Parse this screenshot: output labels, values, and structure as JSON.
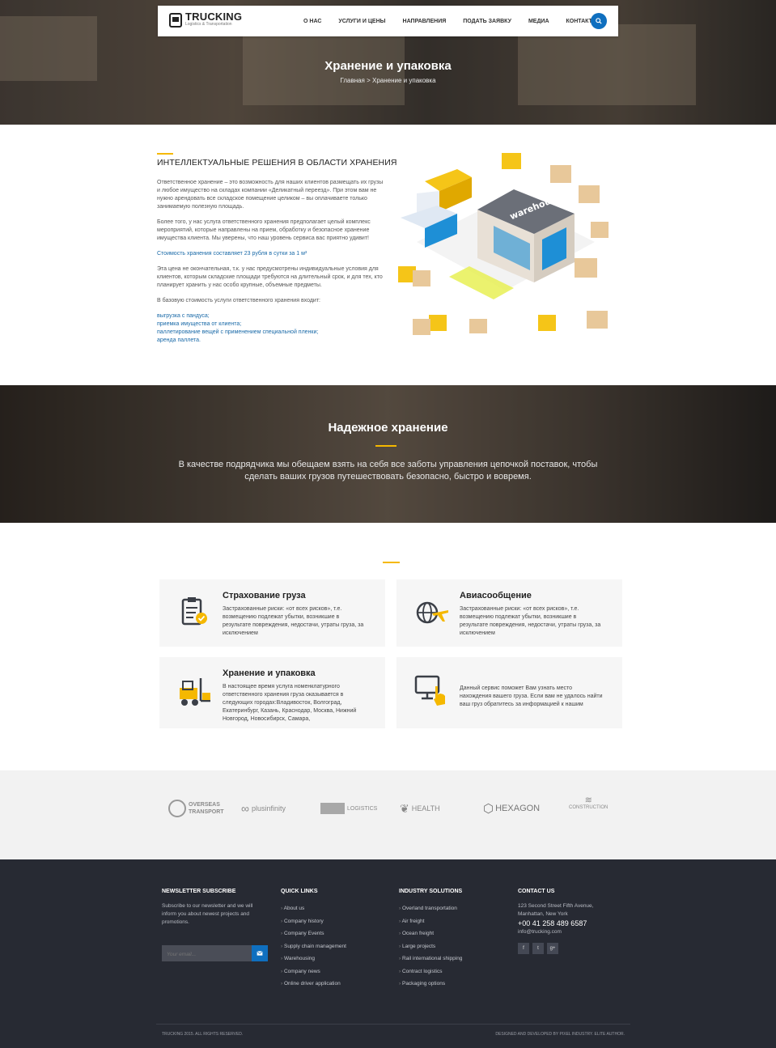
{
  "header": {
    "logo_title": "TRUCKING",
    "logo_subtitle": "Logistics & Transportation",
    "nav": [
      "О НАС",
      "УСЛУГИ И ЦЕНЫ",
      "НАПРАВЛЕНИЯ",
      "ПОДАТЬ ЗАЯВКУ",
      "МЕДИА",
      "КОНТАКТЫ"
    ],
    "page_title": "Хранение и упаковка",
    "breadcrumb": "Главная > Хранение и упаковка"
  },
  "intro": {
    "title": "ИНТЕЛЛЕКТУАЛЬНЫЕ РЕШЕНИЯ В ОБЛАСТИ ХРАНЕНИЯ",
    "p1": "Ответственное хранение – это возможность для наших клиентов размещать их грузы и любое имущество на складах компании «Деликатный переезд». При этом вам не нужно арендовать все складское помещение целиком – вы оплачиваете только занимаемую полезную площадь.",
    "p2": "Более того, у нас услуга ответственного хранения предполагает целый комплекс мероприятий, которые направлены на прием, обработку и безопасное хранение имущества клиента. Мы уверены, что наш уровень сервиса вас приятно удивит!",
    "price": "Стоимость хранения составляет 23 рубля в сутки за 1 м³",
    "p3": "Эта цена не окончательная, т.к. у нас предусмотрены индивидуальные условия для клиентов, которым складские площади требуются на длительный срок, и для тех, кто планирует хранить у нас особо крупные, объемные предметы.",
    "p4": "В базовую стоимость услуги ответственного хранения входит:",
    "list": [
      "выгрузка с пандуса;",
      "приемка имущества от клиента;",
      "паллетирование вещей с применением специальной пленки;",
      "аренда паллета."
    ],
    "illustration_label": "warehouse"
  },
  "banner": {
    "title": "Надежное хранение",
    "text": "В качестве подрядчика мы обещаем взять на себя все заботы управления цепочкой поставок, чтобы сделать ваших грузов путешествовать безопасно, быстро и вовремя."
  },
  "services": [
    {
      "title": "Страхование груза",
      "text": "Застрахованные риски: «от всех рисков», т.е. возмещению подлежат убытки, возникшие в результате повреждения, недостачи, утраты груза, за исключением",
      "icon": "clipboard-check-icon"
    },
    {
      "title": "Авиасообщение",
      "text": "Застрахованные риски: «от всех рисков», т.е. возмещению подлежат убытки, возникшие в результате повреждения, недостачи, утраты груза, за исключением",
      "icon": "globe-plane-icon"
    },
    {
      "title": "Хранение и упаковка",
      "text": "В настоящее время услуга номенклатурного ответственного хранения груза оказывается в следующих городах:Владивосток, Волгоград, Екатеринбург, Казань, Краснодар, Москва, Нижний Новгород, Новосибирск, Самара,",
      "icon": "forklift-icon"
    },
    {
      "title": "",
      "text": "Данный сервис поможет Вам узнать место нахождения вашего груза. Если вам не удалось найти ваш груз обратитесь за информацией к нашим",
      "icon": "monitor-hand-icon"
    }
  ],
  "partners": {
    "p1_line1": "OVERSEAS",
    "p1_line2": "TRANSPORT",
    "p2": "plusinfinity",
    "p3": "LOGISTICS",
    "p4": "HEALTH",
    "p5": "HEXAGON",
    "p6": "CONSTRUCTION"
  },
  "footer": {
    "newsletter_title": "NEWSLETTER SUBSCRIBE",
    "newsletter_text": "Subscribe to our newsletter and we will inform you about newest projects and promotions.",
    "email_placeholder": "Your email...",
    "quick_title": "QUICK LINKS",
    "quick_links": [
      "About us",
      "Company history",
      "Company Events",
      "Supply chain management",
      "Warehousing",
      "Company news",
      "Online driver application"
    ],
    "industry_title": "INDUSTRY SOLUTIONS",
    "industry_links": [
      "Overland transportation",
      "Air freight",
      "Ocean freight",
      "Large projects",
      "Rail international shipping",
      "Contract logistics",
      "Packaging options"
    ],
    "contact_title": "CONTACT US",
    "address1": "123 Second Street Fifth Avenue,",
    "address2": "Manhattan, New York",
    "phone": "+00 41 258 489 6587",
    "email": "info@trucking.com",
    "copyright": "TRUCKING 2015. ALL RIGHTS RESERVED.",
    "credit": "DESIGNED AND DEVELOPED BY PIXEL INDUSTRY. ELITE AUTHOR."
  },
  "colors": {
    "accent": "#f5b800",
    "primary": "#0f6fbf",
    "footer_bg": "#272a33"
  }
}
